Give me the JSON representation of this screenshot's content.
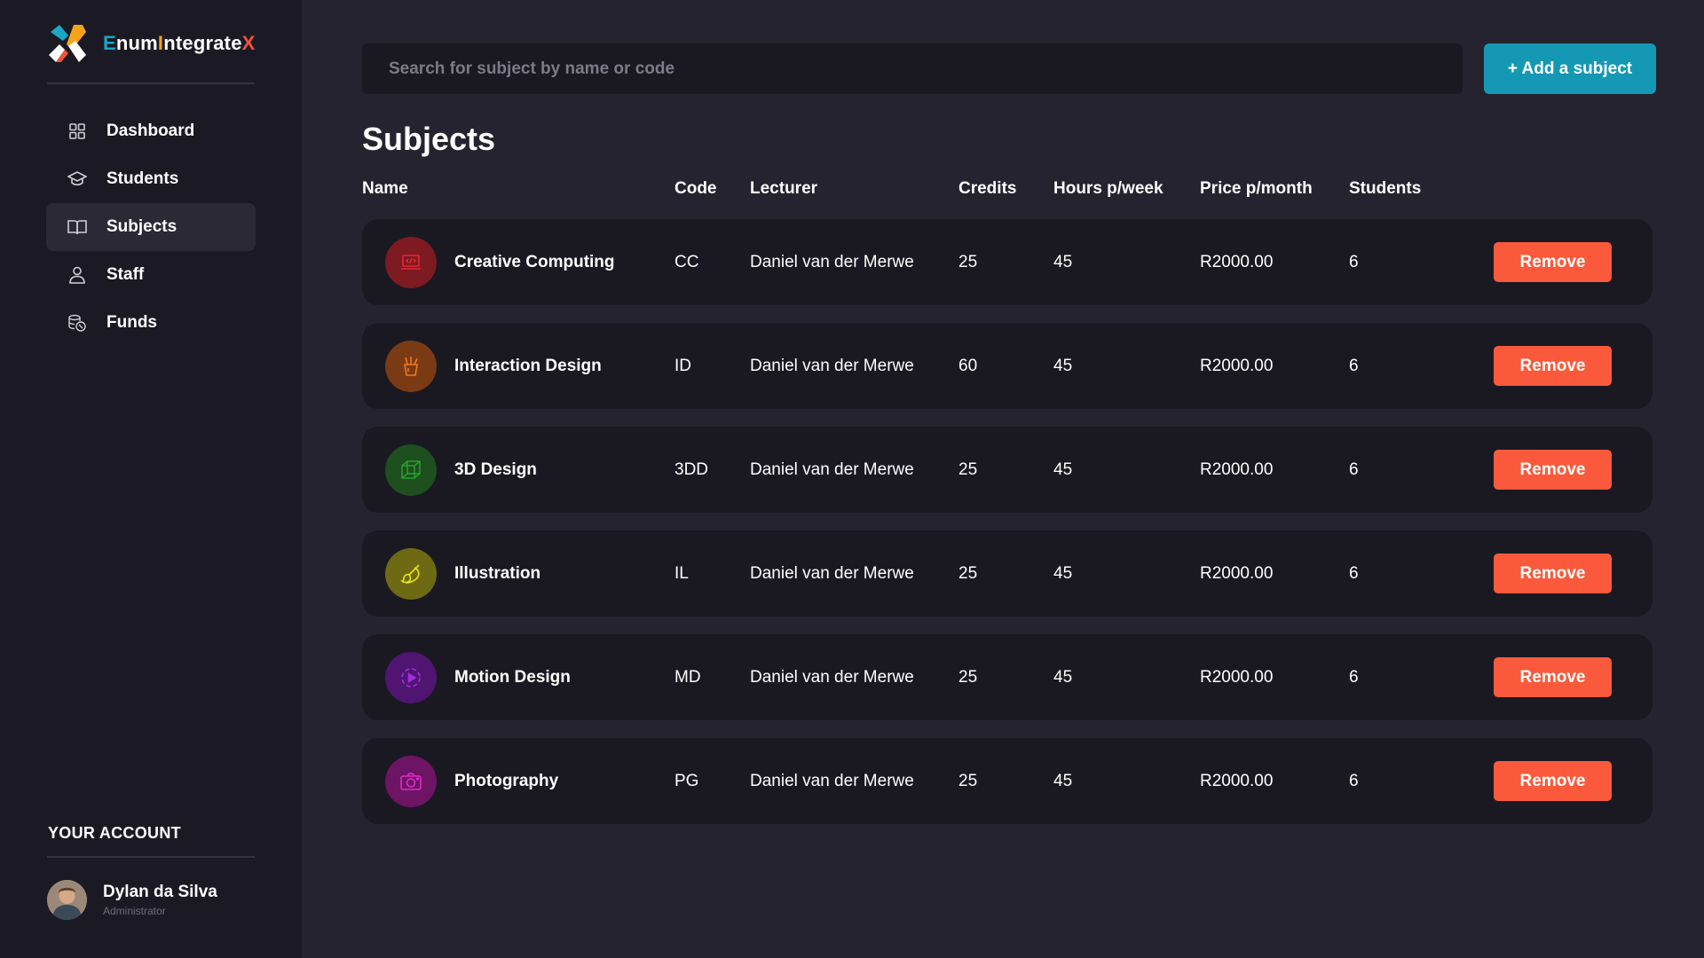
{
  "brand": {
    "name_part1": "E",
    "name_part2": "num",
    "name_part3": "I",
    "name_part4": "ntegrate",
    "name_part5": "X",
    "colors": {
      "teal": "#1aa7c6",
      "orange": "#f7a21b",
      "red": "#f0533a"
    }
  },
  "sidebar": {
    "items": [
      {
        "label": "Dashboard",
        "icon": "grid-icon",
        "active": false
      },
      {
        "label": "Students",
        "icon": "graduation-cap-icon",
        "active": false
      },
      {
        "label": "Subjects",
        "icon": "book-icon",
        "active": true
      },
      {
        "label": "Staff",
        "icon": "user-icon",
        "active": false
      },
      {
        "label": "Funds",
        "icon": "coins-icon",
        "active": false
      }
    ],
    "account_title": "YOUR ACCOUNT",
    "user": {
      "name": "Dylan da Silva",
      "role": "Administrator"
    }
  },
  "search": {
    "placeholder": "Search for subject by name or code",
    "value": ""
  },
  "add_button_label": "+ Add a subject",
  "page_title": "Subjects",
  "table": {
    "headers": [
      "Name",
      "Code",
      "Lecturer",
      "Credits",
      "Hours p/week",
      "Price p/month",
      "Students"
    ],
    "remove_label": "Remove",
    "rows": [
      {
        "name": "Creative Computing",
        "code": "CC",
        "lecturer": "Daniel van der Merwe",
        "credits": "25",
        "hours": "45",
        "price": "R2000.00",
        "students": "6",
        "icon": "code-laptop-icon",
        "color": "#a71620",
        "icon_color": "#e8262f"
      },
      {
        "name": "Interaction Design",
        "code": "ID",
        "lecturer": "Daniel van der Merwe",
        "credits": "60",
        "hours": "45",
        "price": "R2000.00",
        "students": "6",
        "icon": "pencil-cup-icon",
        "color": "#8a3e12",
        "icon_color": "#f07a1c"
      },
      {
        "name": "3D Design",
        "code": "3DD",
        "lecturer": "Daniel van der Merwe",
        "credits": "25",
        "hours": "45",
        "price": "R2000.00",
        "students": "6",
        "icon": "cube-icon",
        "color": "#1c5a1e",
        "icon_color": "#2aa52a"
      },
      {
        "name": "Illustration",
        "code": "IL",
        "lecturer": "Daniel van der Merwe",
        "credits": "25",
        "hours": "45",
        "price": "R2000.00",
        "students": "6",
        "icon": "paint-brush-icon",
        "color": "#807a14",
        "icon_color": "#e8e21c"
      },
      {
        "name": "Motion Design",
        "code": "MD",
        "lecturer": "Daniel van der Merwe",
        "credits": "25",
        "hours": "45",
        "price": "R2000.00",
        "students": "6",
        "icon": "play-circle-icon",
        "color": "#5a1580",
        "icon_color": "#a12ee0"
      },
      {
        "name": "Photography",
        "code": "PG",
        "lecturer": "Daniel van der Merwe",
        "credits": "25",
        "hours": "45",
        "price": "R2000.00",
        "students": "6",
        "icon": "camera-icon",
        "color": "#7a1470",
        "icon_color": "#e02cc8"
      }
    ]
  }
}
